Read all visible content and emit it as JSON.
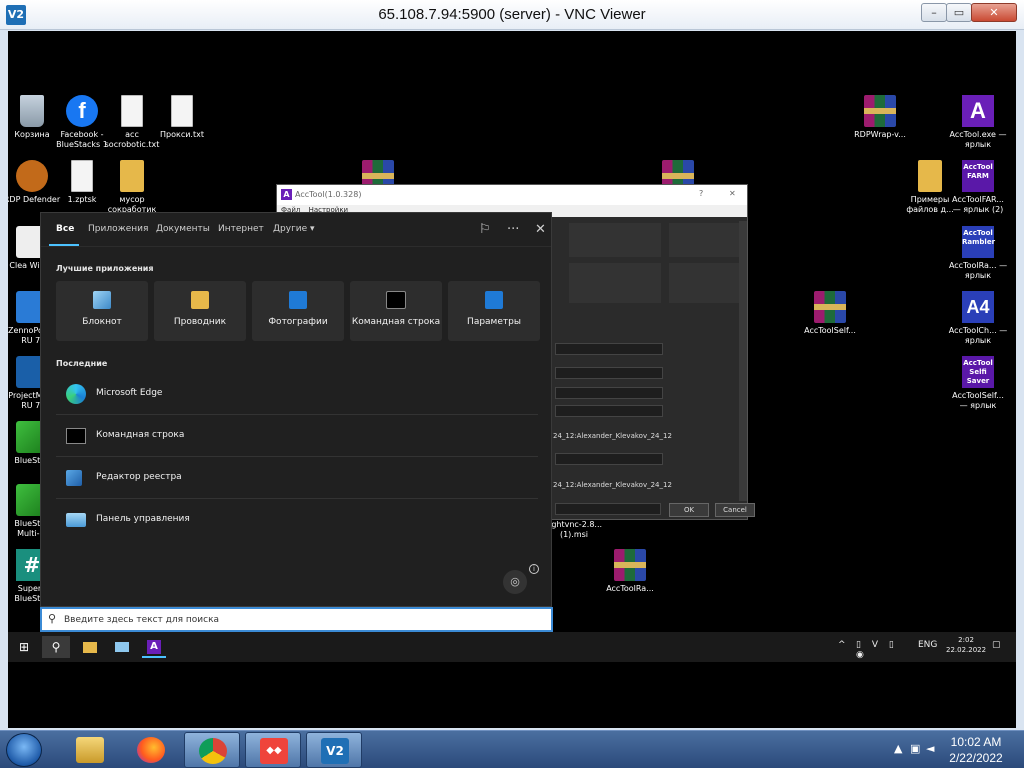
{
  "vnc": {
    "title": "65.108.7.94:5900 (server) - VNC Viewer",
    "logo": "V2",
    "minimize": "–",
    "restore": "▭",
    "close": "✕"
  },
  "desktop_icons": [
    {
      "id": "recycle",
      "label": "Корзина"
    },
    {
      "id": "facebook",
      "label": "Facebook - BlueStacks 1"
    },
    {
      "id": "acc",
      "label": "acc socrobotic.txt"
    },
    {
      "id": "proxy",
      "label": "Прокси.txt"
    },
    {
      "id": "rdpwrap",
      "label": "RDPWrap-v..."
    },
    {
      "id": "acctool-exe",
      "label": "AccTool.exe — ярлык"
    },
    {
      "id": "rdp-defender",
      "label": "RDP Defender"
    },
    {
      "id": "zptsk",
      "label": "1.zptsk"
    },
    {
      "id": "trash-folder",
      "label": "мусор сокработик"
    },
    {
      "id": "examples",
      "label": "Примеры файлов д..."
    },
    {
      "id": "acctool-farm",
      "label": "AccToolFAR... — ярлык (2)"
    },
    {
      "id": "clean",
      "label": "Clea Windo"
    },
    {
      "id": "acctool-rambler",
      "label": "AccToolRa... — ярлык"
    },
    {
      "id": "zenno",
      "label": "ZennoPo V7 RU 7."
    },
    {
      "id": "acctool-self-rar",
      "label": "AccToolSelf..."
    },
    {
      "id": "acctool-ch",
      "label": "AccToolCh... — ярлык"
    },
    {
      "id": "projectm",
      "label": "ProjectM V7 RU 7."
    },
    {
      "id": "acctool-selfi",
      "label": "AccToolSelf... — ярлык"
    },
    {
      "id": "bluestacks",
      "label": "BlueStac"
    },
    {
      "id": "bluestacks-multi",
      "label": "BlueStac Multi-In"
    },
    {
      "id": "tightvnc",
      "label": "tightvnc-2.8... (1).msi"
    },
    {
      "id": "supers",
      "label": "SuperS BlueStac"
    },
    {
      "id": "acctoolra-rar",
      "label": "AccToolRa..."
    }
  ],
  "icon_glyphs": {
    "facebook": "f",
    "acctool_exe": "A",
    "acctool_farm": "AccTool FARM",
    "acctool_rambler": "AccTool Rambler",
    "acctool_ch": "A4",
    "acctool_selfi": "AccTool Selfi Saver",
    "supers": "#"
  },
  "acctool_window": {
    "title": "AccTool(1.0.328)",
    "title_help": "?",
    "title_close": "✕",
    "menu": [
      "Файл",
      "Настройки"
    ],
    "row_text_1": "24_12:Alexander_Klevakov_24_12",
    "row_text_2": "24_12:Alexander_Klevakov_24_12",
    "ok": "OK",
    "cancel": "Cancel"
  },
  "search_panel": {
    "tabs": [
      "Все",
      "Приложения",
      "Документы",
      "Интернет",
      "Другие ▾"
    ],
    "feedback_icon": "⚐",
    "more_icon": "···",
    "close_icon": "✕",
    "top_apps_heading": "Лучшие приложения",
    "top_apps": [
      "Блокнот",
      "Проводник",
      "Фотографии",
      "Командная строка",
      "Параметры"
    ],
    "recent_heading": "Последние",
    "recent": [
      "Microsoft Edge",
      "Командная строка",
      "Редактор реестра",
      "Панель управления"
    ],
    "lens_icon": "◎",
    "info_icon": "i",
    "search_icon": "⚲",
    "search_placeholder": "Введите здесь текст для поиска"
  },
  "remote_taskbar": {
    "start": "⊞",
    "search": "⚲",
    "tray_up": "^",
    "lang": "ENG",
    "time": "2:02",
    "date": "22.02.2022",
    "notif": "▢",
    "acctool_glyph": "A"
  },
  "host_taskbar": {
    "time": "10:02 AM",
    "date": "2/22/2022",
    "tray_up": "▲",
    "network": "▣",
    "volume": "◄",
    "anydesk_glyph": "◆◆",
    "vnc_glyph": "V2"
  },
  "colors": {
    "accent": "#4cc2ff",
    "acctool_purple": "#6a1fb8",
    "search_border": "#3b8bd6"
  }
}
